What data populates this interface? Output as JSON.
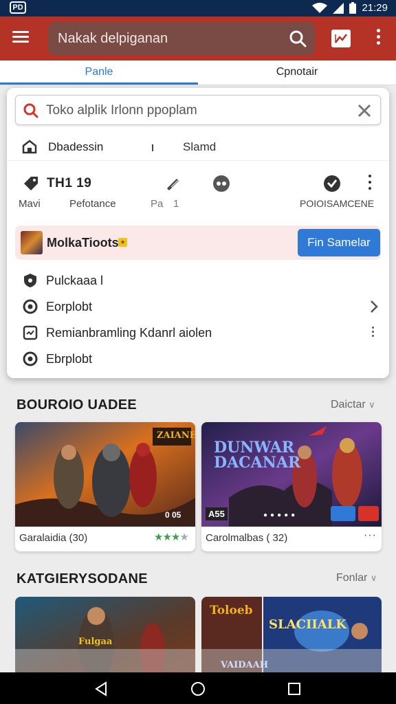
{
  "status_bar": {
    "left_icon": "pd-icon",
    "left_text": "PD",
    "time": "21:29",
    "icons": [
      "wifi-icon",
      "signal-icon",
      "battery-icon"
    ]
  },
  "app_bar": {
    "search_text": "Nakak delpiganan",
    "icons": [
      "menu-icon",
      "search-icon",
      "chart-icon",
      "more-icon"
    ]
  },
  "tabs": [
    {
      "label": "Panle",
      "active": true
    },
    {
      "label": "Cpnotair",
      "active": false
    }
  ],
  "dropdown": {
    "search_placeholder": "Toko alplik Irlonn ppoplam",
    "row_a": {
      "label_left": "Dbadessin",
      "label_right": "Slamd"
    },
    "icon_row": {
      "title": "TH1 19",
      "labels": [
        "Mavi",
        "Pefotance",
        "Pa",
        "1",
        "POIOISAMCENE"
      ]
    },
    "promo": {
      "title": "MolkaTioots",
      "button": "Fin Samelar"
    },
    "menu": [
      {
        "label": "Pulckaaa l",
        "icon": "shield-icon"
      },
      {
        "label": "Eorplobt",
        "icon": "target-icon",
        "right": "chevron-right-icon"
      },
      {
        "label": "Remianbramling Kdanrl aiolen",
        "icon": "tray-icon",
        "right": "more-vert-icon"
      },
      {
        "label": "Ebrplobt",
        "icon": "target-icon"
      }
    ]
  },
  "section1": {
    "title": "BOUROIO UADEE",
    "link": "Daictar",
    "cards": [
      {
        "caption": "Garalaidia (30)",
        "image_text": "ZAIANES",
        "counter": "0 05",
        "rating_stars": 4
      },
      {
        "caption": "Carolmalbas ( 32)",
        "image_text": "DUNWAR DACANAR",
        "badge": "A55"
      }
    ]
  },
  "section2": {
    "title": "KATGIERYSODANE",
    "link": "Fonlar",
    "cards": [
      {
        "image_text": "Fulgaa"
      },
      {
        "image_text": "Toloeb",
        "image_text_2": "SLACIIALK",
        "image_text_3": "VAIDAAH"
      }
    ]
  },
  "colors": {
    "app_bar": "#b53227",
    "status_bar": "#0e2950",
    "accent": "#2a7bd0",
    "promo_button": "#2f7ad6",
    "promo_bg": "#fbe9e9",
    "stars": "#3aa14a"
  }
}
